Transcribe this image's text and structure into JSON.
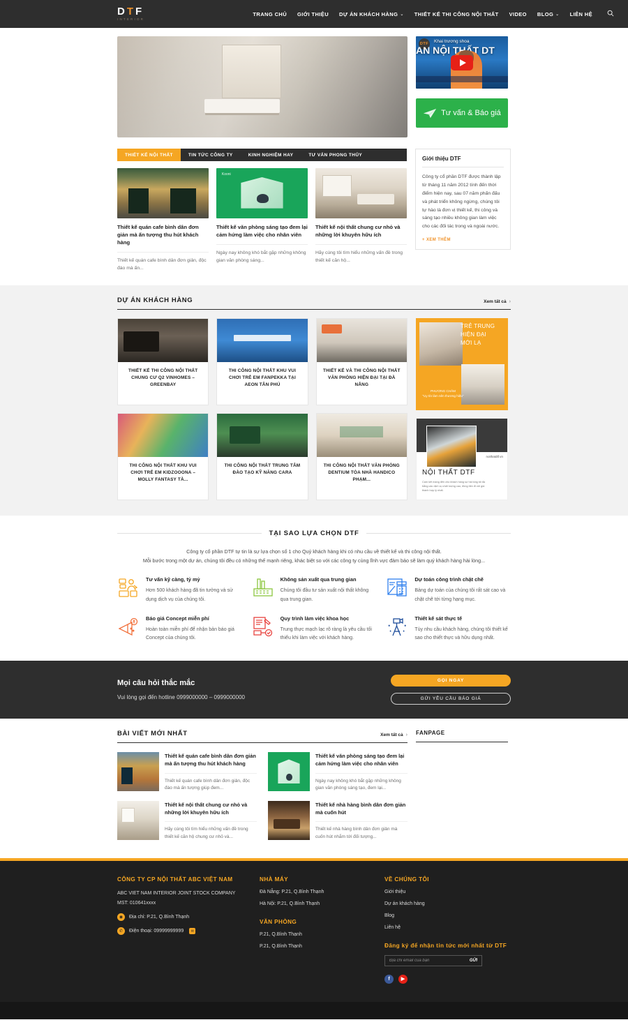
{
  "header": {
    "logo_main": "DTF",
    "logo_accent_char": "T",
    "logo_sub": "INTERIOR",
    "nav": [
      {
        "label": "TRANG CHỦ",
        "caret": false
      },
      {
        "label": "GIỚI THIỆU",
        "caret": false
      },
      {
        "label": "DỰ ÁN KHÁCH HÀNG",
        "caret": true
      },
      {
        "label": "THIẾT KẾ THI CÔNG NỘI THẤT",
        "caret": false
      },
      {
        "label": "VIDEO",
        "caret": false
      },
      {
        "label": "BLOG",
        "caret": true
      },
      {
        "label": "LIÊN HỆ",
        "caret": false
      }
    ],
    "search_icon": "search-icon",
    "caret_glyph": "⌄",
    "bg_color": "#2e2e2e"
  },
  "hero": {
    "banner_alt": "Không gian nội thất văn phòng",
    "video": {
      "channel_badge": "DTF",
      "overlay_title": "Khai trương shoa",
      "overlay_big": "AN NỘI THẤT DT",
      "play_label": "play-button"
    },
    "consult_button": "Tư vấn & Báo giá",
    "consult_color": "#2cb14a"
  },
  "news": {
    "tabs": [
      {
        "label": "THIẾT KẾ NỘI THẤT",
        "active": true
      },
      {
        "label": "TIN TỨC CÔNG TY",
        "active": false
      },
      {
        "label": "KINH NGHIỆM HAY",
        "active": false
      },
      {
        "label": "TƯ VẤN PHONG THỦY",
        "active": false
      }
    ],
    "active_tab_color": "#f5a623",
    "cards": [
      {
        "title": "Thiết kế quán cafe bình dân đơn giản mà ấn tượng thu hút khách hàng",
        "excerpt": "Thiết kế quán cafe bình dân đơn giản, độc đáo mà ấn..."
      },
      {
        "title": "Thiết kế văn phòng sáng tạo đem lại cảm hứng làm việc cho nhân viên",
        "excerpt": "Ngày nay không khó bắt gặp những không gian văn phòng sáng..."
      },
      {
        "title": "Thiết kế nội thất chung cư nhỏ và những lời khuyên hữu ích",
        "excerpt": "Hãy cùng tôi tìm hiểu những vấn đề trong thiết kế căn hộ..."
      }
    ],
    "about": {
      "title": "Giới thiệu DTF",
      "text": "Công ty cổ phần DTF được thành lập từ tháng 11 năm 2012 tính đến thời điểm hiện nay, sau 07 năm phấn đấu và phát triển không ngừng, chúng tôi tự hào là đơn vị thiết kế, thi công và sáng tạo nhiều không gian làm việc cho các đối tác trong và ngoài nước.",
      "more": "+ XEM THÊM"
    }
  },
  "projects": {
    "title": "DỰ ÁN KHÁCH HÀNG",
    "see_all": "Xem tất cả",
    "arrow_glyph": "›",
    "items": [
      {
        "name": "THIẾT KẾ THI CÔNG NỘI THẤT CHUNG CƯ Q2 VINHOMES – GREENBAY"
      },
      {
        "name": "THI CÔNG NỘI THẤT KHU VUI CHƠI TRẺ EM FANPEKKA TẠI AEON TÂN PHÚ"
      },
      {
        "name": "THIẾT KẾ VÀ THI CÔNG NỘI THẤT VĂN PHÒNG HIỆN ĐẠI TẠI ĐÀ NẴNG"
      },
      {
        "name": "THI CÔNG NỘI THẤT KHU VUI CHƠI TRẺ EM KIDZOOONA – MOLLY FANTASY TÀ..."
      },
      {
        "name": "THI CÔNG NỘI THẤT TRUNG TÂM ĐÀO TẠO KỸ NĂNG CARA"
      },
      {
        "name": "THI CÔNG NỘI THẤT VĂN PHÒNG DENTIUM TÒA NHÀ HANDICO PHẠM..."
      }
    ],
    "banner_a": {
      "line1": "TRẺ TRUNG",
      "line2": "HIỆN ĐẠI",
      "line3": "MỚI LẠ",
      "motto_label": "PHƯƠNG CHÂM",
      "motto_text": "\"Uy tín làm nên thương hiệu\"",
      "bg_color": "#f5a623"
    },
    "banner_b": {
      "url": "noithatdtf.vn",
      "title": "NỘI THẤT DTF",
      "desc": "Cam kết mang đến cho khách hàng sự hài lòng tối đa bằng các dịch vụ chất lượng cao, đồng tiền đi với giá thành hợp lý nhất."
    }
  },
  "why": {
    "title": "TẠI SAO LỰA CHỌN DTF",
    "lead_line1": "Công ty cổ phần DTF tự tin là sự lựa chọn số 1 cho Quý khách hàng khi có nhu cầu về thiết kế và thi công nội thất.",
    "lead_line2": "Mỗi bước trong một dự án, chúng tôi đều có những thế mạnh riêng, khác biệt so với các công ty cùng lĩnh vực đảm bảo sẽ làm quý khách hàng hài lòng...",
    "items": [
      {
        "icon": "consultant-icon",
        "color": "#f5a623",
        "heading": "Tư vấn kỹ càng, tỷ mỷ",
        "text": "Hơn 500 khách hàng đã tin tưởng và sử dụng dịch vụ của chúng tôi."
      },
      {
        "icon": "factory-icon",
        "color": "#8cc63f",
        "heading": "Không sản xuất qua trung gian",
        "text": "Chúng tôi đầu tư sản xuất nội thất không qua trung gian."
      },
      {
        "icon": "calculator-icon",
        "color": "#2f80ed",
        "heading": "Dự toán công trình chặt chẽ",
        "text": "Bảng dự toán của chúng tôi rất sát cao và chặt chẽ tới từng hạng mục."
      },
      {
        "icon": "megaphone-icon",
        "color": "#f2713c",
        "heading": "Báo giá Concept miễn phí",
        "text": "Hoàn toàn miễn phí để nhận bản báo giá Concept của chúng tôi."
      },
      {
        "icon": "workflow-icon",
        "color": "#e8433f",
        "heading": "Quy trình làm việc khoa học",
        "text": "Trung thực mạch lạc rõ ràng là yêu cầu tối thiểu khi làm việc với khách hàng."
      },
      {
        "icon": "surveyor-icon",
        "color": "#1f4e9c",
        "heading": "Thiết kế sát thực tế",
        "text": "Tùy nhu cầu khách hàng, chúng tôi thiết kế sao cho thiết thực và hữu dụng nhất."
      }
    ]
  },
  "dark_cta": {
    "heading": "Mọi câu hỏi thắc mắc",
    "subtext": "Vui lòng gọi đến hotline 0999000000 – 0999000000",
    "call_button": "GỌI NGAY",
    "quote_button": "GỬI YÊU CẦU BÁO GIÁ",
    "call_color": "#f5a623"
  },
  "latest": {
    "title": "BÀI VIẾT MỚI NHẤT",
    "see_all": "Xem tất cả",
    "arrow_glyph": "›",
    "fanpage_title": "FANPAGE",
    "posts": [
      {
        "title": "Thiết kế quán cafe bình dân đơn giản mà ấn tượng thu hút khách hàng",
        "excerpt": "Thiết kế quán cafe bình dân đơn giản, độc đáo mà ấn tượng giúp đem..."
      },
      {
        "title": "Thiết kế văn phòng sáng tạo đem lại cảm hứng làm việc cho nhân viên",
        "excerpt": "Ngày nay không khó bắt gặp những không gian văn phòng sáng tạo, đem lại..."
      },
      {
        "title": "Thiết kế nội thất chung cư nhỏ và những lời khuyên hữu ích",
        "excerpt": "Hãy cùng tôi tìm hiểu những vấn đề trong thiết kế căn hộ chung cư nhỏ và..."
      },
      {
        "title": "Thiết kế nhà hàng bình dân đơn giản mà cuốn hút",
        "excerpt": "Thiết kế nhà hàng bình dân đơn giản mà cuốn hút nhắm tới đối tượng..."
      }
    ]
  },
  "footer": {
    "accent_color": "#f5a623",
    "company": {
      "heading": "CÔNG TY CP NỘI THẤT ABC VIỆT NAM",
      "en_name": "ABC VIET NAM INTERIOR JOINT STOCK COMPANY",
      "tax": "MST: 010641xxxx",
      "address_icon": "location-pin-icon",
      "address": "Địa chỉ: P.21, Q.Bình Thạnh",
      "phone_icon": "phone-icon",
      "phone": "Điện thoại: 09999999999"
    },
    "factory": {
      "heading": "NHÀ MÁY",
      "lines": [
        "Đà Nẵng: P.21, Q.Bình Thạnh",
        "Hà Nội:  P.21, Q.Bình Thạnh"
      ],
      "office_heading": "VĂN PHÒNG",
      "office_lines": [
        " P.21, Q.Bình Thạnh",
        "P.21, Q.Bình Thạnh"
      ]
    },
    "about": {
      "heading": "VỀ CHÚNG TÔI",
      "links": [
        "Giới thiệu",
        "Dự án khách hàng",
        "Blog",
        "Liên hệ"
      ],
      "subscribe_heading": "Đăng ký để nhận tin tức mới nhất từ DTF",
      "subscribe_placeholder": "Địa chỉ email của bạn",
      "subscribe_button": "GỬI",
      "socials": [
        {
          "name": "facebook-icon",
          "glyph": "f",
          "color": "#3b5998"
        },
        {
          "name": "youtube-icon",
          "glyph": "▶",
          "color": "#e62117"
        }
      ]
    }
  }
}
